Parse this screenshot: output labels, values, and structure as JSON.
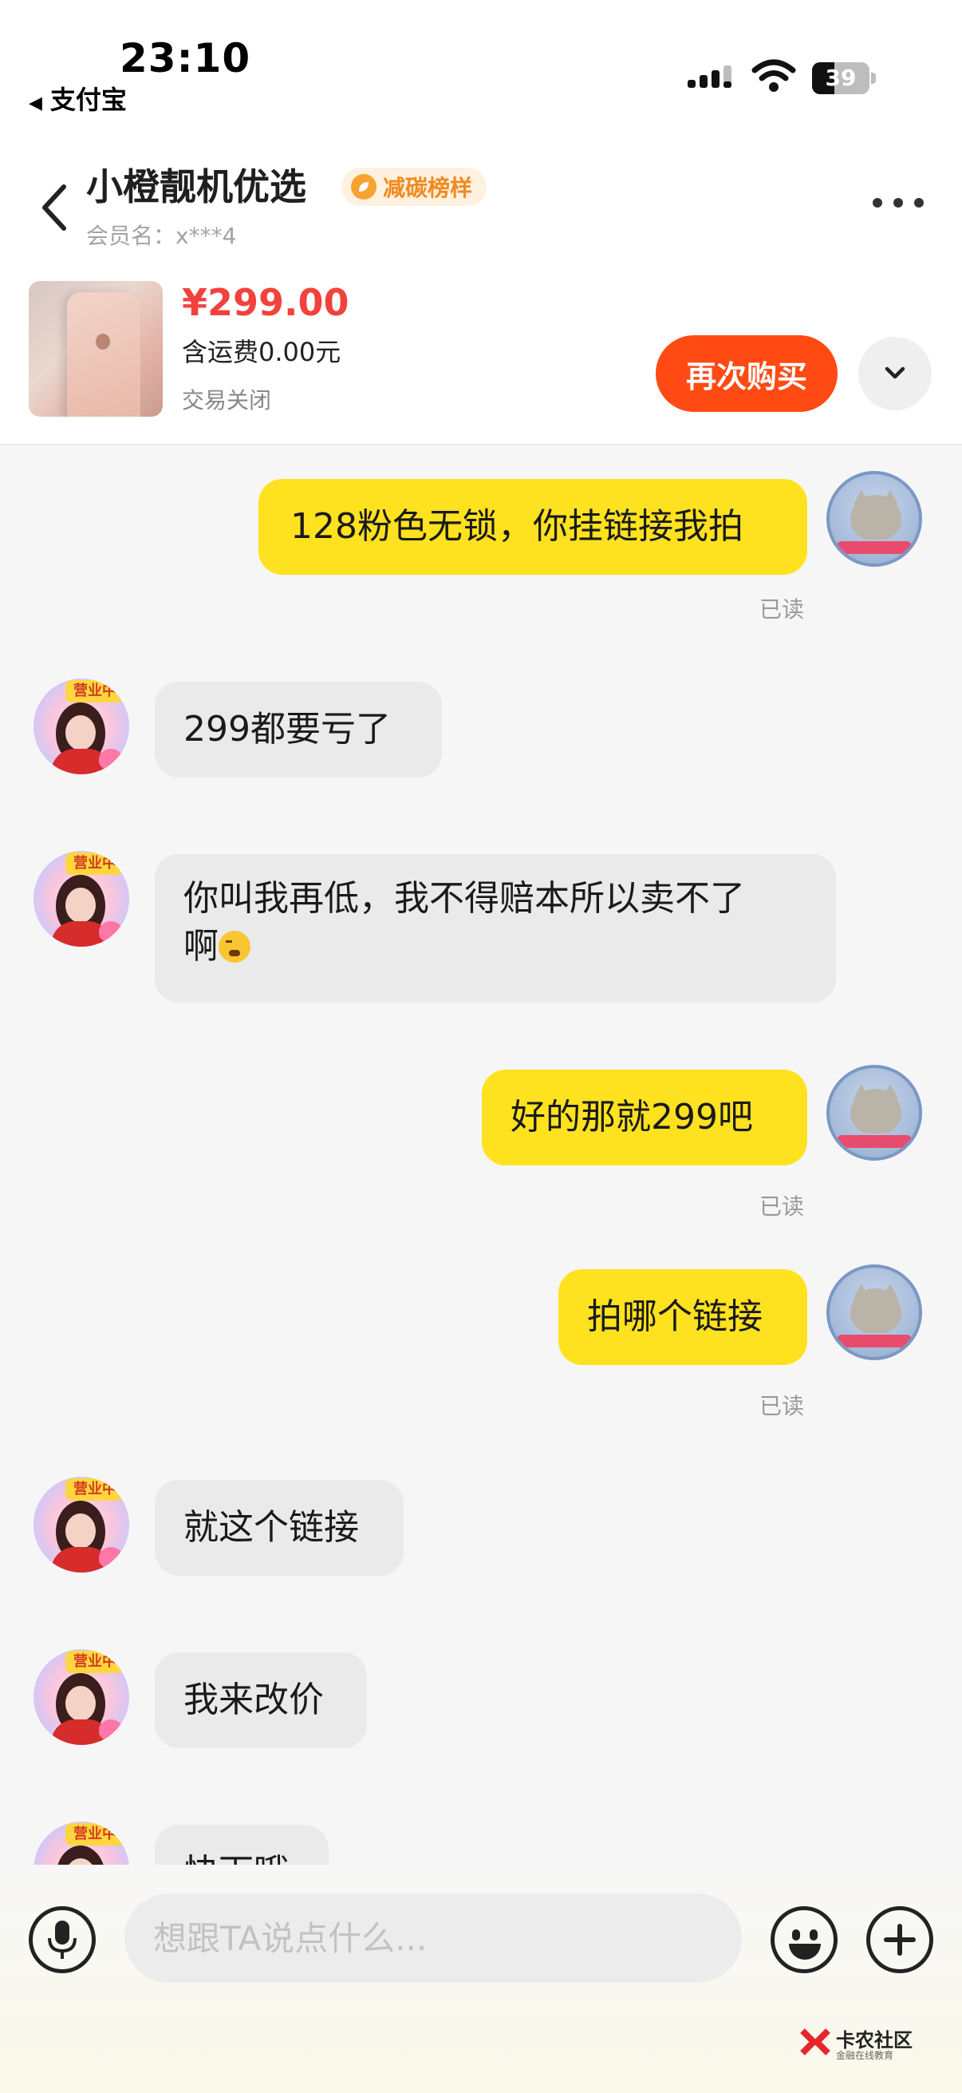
{
  "status_bar": {
    "time": "23:10",
    "back_app": "支付宝",
    "battery": "39",
    "battery_level": 0.39
  },
  "header": {
    "shop_name": "小橙靓机优选",
    "badge": "减碳榜样",
    "member_label": "会员名：x***4",
    "product": {
      "price": "¥299.00",
      "shipping": "含运费0.00元",
      "status": "交易关闭"
    },
    "rebuy_label": "再次购买"
  },
  "messages": [
    {
      "from": "me",
      "text": "128粉色无锁，你挂链接我拍",
      "read": "已读"
    },
    {
      "from": "them",
      "text": "299都要亏了"
    },
    {
      "from": "them",
      "text_line1": "你叫我再低，我不得赔本所以卖不了",
      "text_line2": "啊"
    },
    {
      "from": "me",
      "text": "好的那就299吧",
      "read": "已读"
    },
    {
      "from": "me",
      "text": "拍哪个链接",
      "read": "已读"
    },
    {
      "from": "them",
      "text": "就这个链接"
    },
    {
      "from": "them",
      "text": "我来改价"
    },
    {
      "from": "them",
      "text": "快下哦"
    }
  ],
  "avatar_tag": "营业中",
  "input": {
    "placeholder": "想跟TA说点什么..."
  },
  "watermark": {
    "title": "卡农社区",
    "subtitle": "金融在线教育"
  },
  "colors": {
    "accent_orange": "#ff4a14",
    "price_red": "#f2423d",
    "my_bubble": "#ffe21f",
    "their_bubble": "#eaeaea"
  },
  "icons": [
    "back-chevron-icon",
    "more-dots-icon",
    "chevron-down-icon",
    "microphone-icon",
    "smiley-icon",
    "plus-icon",
    "signal-icon",
    "wifi-icon",
    "battery-icon"
  ]
}
